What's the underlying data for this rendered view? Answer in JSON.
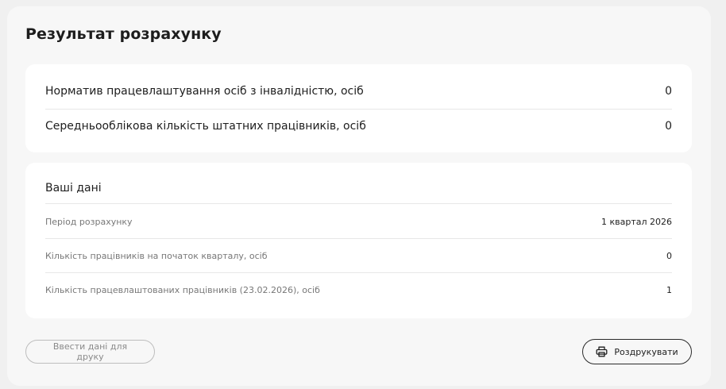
{
  "result": {
    "title": "Результат розрахунку",
    "rows": [
      {
        "label": "Норматив працевлаштування осіб з інвалідністю, осіб",
        "value": "0"
      },
      {
        "label": "Середньооблікова кількість штатних працівників, осіб",
        "value": "0"
      }
    ]
  },
  "your_data": {
    "heading": "Ваші дані",
    "rows": [
      {
        "label": "Період розрахунку",
        "value": "1 квартал 2026"
      },
      {
        "label": "Кількість працівників на початок кварталу, осіб",
        "value": "0"
      },
      {
        "label": "Кількість працевлаштованих працівників (23.02.2026), осіб",
        "value": "1"
      }
    ]
  },
  "actions": {
    "enter_label": "Ввести дані для друку",
    "print_label": "Роздрукувати",
    "print_icon": "printer-icon"
  }
}
